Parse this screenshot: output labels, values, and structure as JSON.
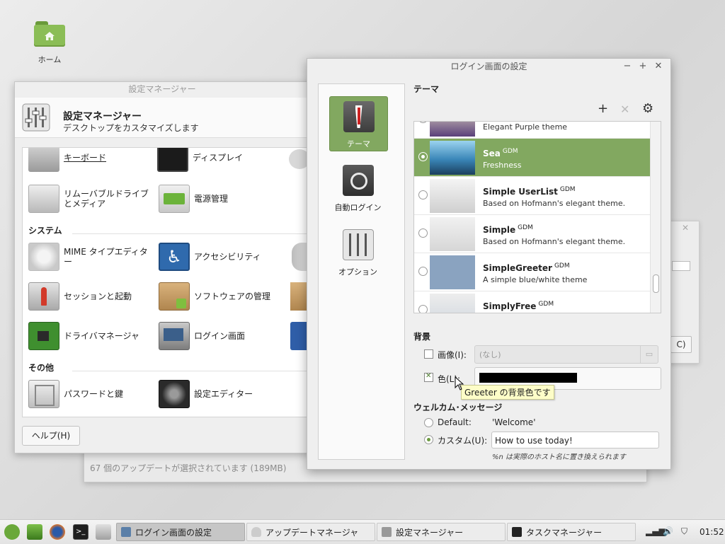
{
  "desktop": {
    "home_label": "ホーム"
  },
  "update_manager": {
    "status": "67 個のアップデートが選択されています (189MB)"
  },
  "small_dialog": {
    "button_fragment": "C)"
  },
  "settings_manager": {
    "window_title": "設定マネージャー",
    "header_title": "設定マネージャー",
    "header_subtitle": "デスクトップをカスタマイズします",
    "row_top": [
      {
        "label": "キーボード",
        "icon": "keyboard-icon"
      },
      {
        "label": "ディスプレイ",
        "icon": "display-icon"
      }
    ],
    "row_hardware": [
      {
        "label": "リムーバブルドライブとメディア",
        "icon": "removable-drive-icon"
      },
      {
        "label": "電源管理",
        "icon": "power-icon"
      }
    ],
    "section_system": "システム",
    "system_items": [
      {
        "label": "MIME タイプエディター",
        "icon": "mime-gears-icon"
      },
      {
        "label": "アクセシビリティ",
        "icon": "accessibility-icon"
      },
      {
        "label": "セッションと起動",
        "icon": "rocket-icon"
      },
      {
        "label": "ソフトウェアの管理",
        "icon": "package-icon"
      },
      {
        "label": "ドライバマネージャ",
        "icon": "circuit-board-icon"
      },
      {
        "label": "ログイン画面",
        "icon": "login-screen-icon"
      }
    ],
    "section_other": "その他",
    "other_items": [
      {
        "label": "パスワードと鍵",
        "icon": "safe-icon"
      },
      {
        "label": "設定エディター",
        "icon": "settings-editor-icon"
      }
    ],
    "help_button": "ヘルプ(H)"
  },
  "login_settings": {
    "window_title": "ログイン画面の設定",
    "window_buttons": {
      "minimize": "−",
      "maximize": "+",
      "close": "✕"
    },
    "sidebar": [
      {
        "label": "テーマ",
        "icon": "suit-tie-icon",
        "active": true
      },
      {
        "label": "自動ログイン",
        "icon": "auto-login-icon",
        "active": false
      },
      {
        "label": "オプション",
        "icon": "options-sliders-icon",
        "active": false
      }
    ],
    "theme_heading": "テーマ",
    "theme_tools": {
      "add": "+",
      "remove": "✕",
      "settings": "⚙"
    },
    "themes": [
      {
        "name": "",
        "tag": "",
        "desc": "Elegant Purple theme",
        "selected": false
      },
      {
        "name": "Sea",
        "tag": "GDM",
        "desc": "Freshness",
        "selected": true
      },
      {
        "name": "Simple UserList",
        "tag": "GDM",
        "desc": "Based on Hofmann's elegant theme.",
        "selected": false
      },
      {
        "name": "Simple",
        "tag": "GDM",
        "desc": "Based on Hofmann's elegant theme.",
        "selected": false
      },
      {
        "name": "SimpleGreeter",
        "tag": "GDM",
        "desc": "A simple blue/white theme",
        "selected": false
      },
      {
        "name": "SimplyFree",
        "tag": "GDM",
        "desc": "",
        "selected": false
      }
    ],
    "background_heading": "背景",
    "image_label": "画像(I):",
    "image_value": "(なし)",
    "color_label": "色(L):",
    "color_value": "#000000",
    "tooltip": "Greeter の背景色です",
    "welcome_heading": "ウェルカム･メッセージ",
    "default_label": "Default:",
    "default_value": "'Welcome'",
    "custom_label": "カスタム(U):",
    "custom_value": "How to use today!",
    "hint": "%n は実際のホスト名に置き換えられます"
  },
  "taskbar": {
    "tasks": [
      {
        "label": "ログイン画面の設定",
        "active": true
      },
      {
        "label": "アップデートマネージャ",
        "active": false
      },
      {
        "label": "設定マネージャー",
        "active": false
      },
      {
        "label": "タスクマネージャー",
        "active": false
      }
    ],
    "clock": "01:52"
  }
}
